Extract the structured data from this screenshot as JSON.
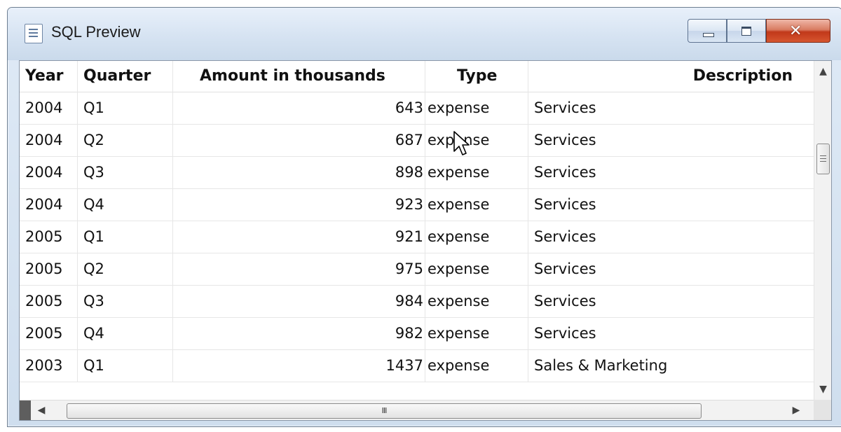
{
  "window": {
    "title": "SQL Preview",
    "icon": "document-list-icon"
  },
  "caption_buttons": {
    "minimize_icon": "minimize-icon",
    "maximize_icon": "maximize-icon",
    "close_label": "✕"
  },
  "table": {
    "columns": [
      "Year",
      "Quarter",
      "Amount in thousands",
      "Type",
      "Description"
    ],
    "rows": [
      [
        "2004",
        "Q1",
        "643",
        "expense",
        "Services"
      ],
      [
        "2004",
        "Q2",
        "687",
        "expense",
        "Services"
      ],
      [
        "2004",
        "Q3",
        "898",
        "expense",
        "Services"
      ],
      [
        "2004",
        "Q4",
        "923",
        "expense",
        "Services"
      ],
      [
        "2005",
        "Q1",
        "921",
        "expense",
        "Services"
      ],
      [
        "2005",
        "Q2",
        "975",
        "expense",
        "Services"
      ],
      [
        "2005",
        "Q3",
        "984",
        "expense",
        "Services"
      ],
      [
        "2005",
        "Q4",
        "982",
        "expense",
        "Services"
      ],
      [
        "2003",
        "Q1",
        "1437",
        "expense",
        "Sales & Marketing"
      ]
    ]
  },
  "scrollbars": {
    "vertical": {
      "up_glyph": "▲",
      "down_glyph": "▼"
    },
    "horizontal": {
      "left_glyph": "◀",
      "right_glyph": "▶",
      "thumb_glyph": "III"
    }
  }
}
